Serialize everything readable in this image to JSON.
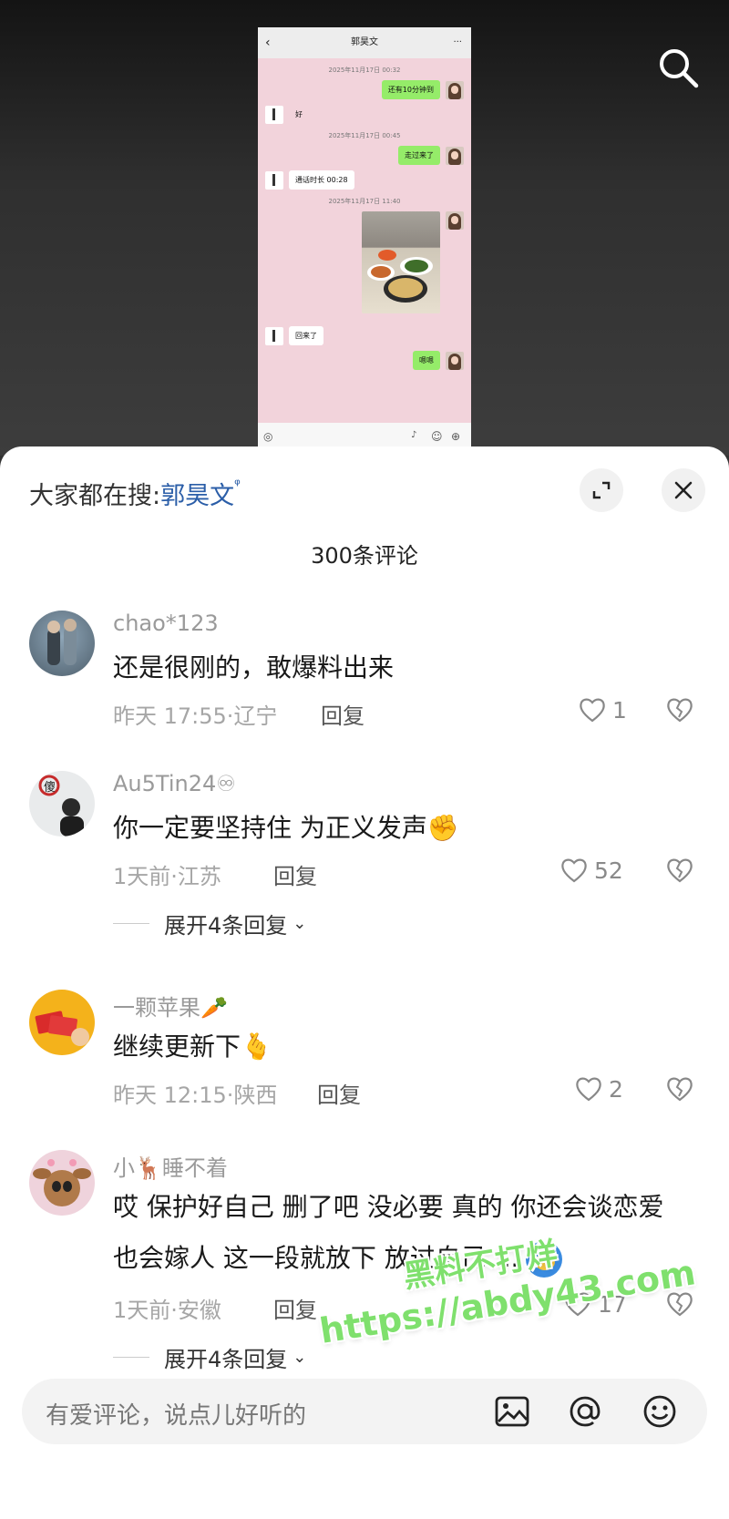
{
  "chat_preview": {
    "contact_name": "郭昊文",
    "messages": [
      {
        "type": "time",
        "text": "2025年11月17日 00:32"
      },
      {
        "type": "sent",
        "text": "还有10分钟到"
      },
      {
        "type": "received",
        "text": "好"
      },
      {
        "type": "time",
        "text": "2025年11月17日 00:45"
      },
      {
        "type": "sent",
        "text": "走过来了"
      },
      {
        "type": "received",
        "text": "通话时长 00:28"
      },
      {
        "type": "time",
        "text": "2025年11月17日 11:40"
      },
      {
        "type": "received",
        "text": "回来了"
      },
      {
        "type": "sent",
        "text": "嗯嗯"
      }
    ]
  },
  "search_hint": {
    "prefix": "大家都在搜:",
    "keyword": "郭昊文"
  },
  "comment_count": "300条评论",
  "comments": [
    {
      "username": "chao*123",
      "text": "还是很刚的，敢爆料出来",
      "time": "昨天 17:55",
      "location": "辽宁",
      "reply_label": "回复",
      "likes": "1"
    },
    {
      "username": "Au5Tin24♾",
      "text": "你一定要坚持住 为正义发声✊",
      "time": "1天前",
      "location": "江苏",
      "reply_label": "回复",
      "likes": "52",
      "expand": "展开4条回复"
    },
    {
      "username": "一颗苹果🥕",
      "text": "继续更新下🫰",
      "time": "昨天 12:15",
      "location": "陕西",
      "reply_label": "回复",
      "likes": "2"
    },
    {
      "username": "小🦌睡不着",
      "text_line1": "哎 保护好自己 删了吧 没必要 真的 你还会谈恋爱",
      "text_line2": "也会嫁人 这一段就放下 放过自己 ...",
      "time": "1天前",
      "location": "安徽",
      "reply_label": "回复",
      "likes": "17",
      "expand": "展开4条回复"
    }
  ],
  "comment_input": {
    "placeholder": "有爱评论，说点儿好听的"
  },
  "watermark": {
    "line1": "黑料不打烊",
    "line2": "https://abdy43.com"
  },
  "colors": {
    "accent": "#2b5ea8",
    "bubble_green": "#95ec69",
    "chat_bg": "#f2d3db"
  },
  "icons": [
    "search-icon",
    "expand-icon",
    "close-icon",
    "heart-icon",
    "broken-heart-icon",
    "chevron-down-icon",
    "image-icon",
    "at-icon",
    "emoji-icon"
  ]
}
